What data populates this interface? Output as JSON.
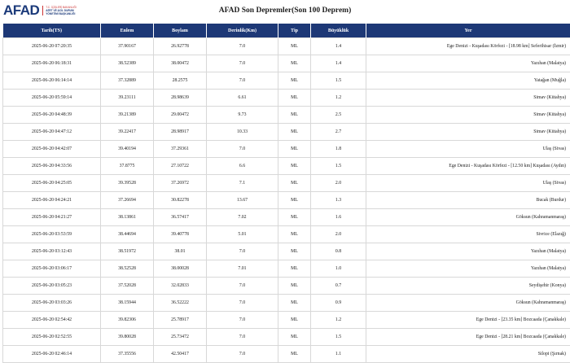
{
  "header": {
    "logo_text": "AFAD",
    "logo_sub": [
      "T.C. İÇİŞLERİ BAKANLIĞI",
      "AFET VE ACİL DURUM",
      "YÖNETİMİ BAŞKANLIĞI"
    ],
    "title": "AFAD Son Depremler(Son 100 Deprem)"
  },
  "columns": [
    "Tarih(TS)",
    "Enlem",
    "Boylam",
    "Derinlik(Km)",
    "Tip",
    "Büyüklük",
    "Yer"
  ],
  "rows": [
    [
      "2025-06-20 07:20:35",
      "37.90167",
      "26.92778",
      "7.0",
      "ML",
      "1.4",
      "Ege Denizi - Kuşadası Körfezi - [18.98 km] Seferihisar (İzmir)"
    ],
    [
      "2025-06-20 06:18:31",
      "38.52389",
      "38.00472",
      "7.0",
      "ML",
      "1.4",
      "Yazıhan (Malatya)"
    ],
    [
      "2025-06-20 06:14:14",
      "37.32889",
      "28.2575",
      "7.0",
      "ML",
      "1.5",
      "Yatağan (Muğla)"
    ],
    [
      "2025-06-20 05:59:14",
      "39.23111",
      "28.98639",
      "6.61",
      "ML",
      "1.2",
      "Simav (Kütahya)"
    ],
    [
      "2025-06-20 04:48:39",
      "39.21389",
      "29.00472",
      "9.73",
      "ML",
      "2.5",
      "Simav (Kütahya)"
    ],
    [
      "2025-06-20 04:47:12",
      "39.22417",
      "28.98917",
      "10.33",
      "ML",
      "2.7",
      "Simav (Kütahya)"
    ],
    [
      "2025-06-20 04:42:07",
      "39.40194",
      "37.29361",
      "7.0",
      "ML",
      "1.8",
      "Ulaş (Sivas)"
    ],
    [
      "2025-06-20 04:33:56",
      "37.8775",
      "27.10722",
      "6.6",
      "ML",
      "1.5",
      "Ege Denizi - Kuşadası Körfezi - [12.50 km] Kuşadası (Aydın)"
    ],
    [
      "2025-06-20 04:25:05",
      "39.39528",
      "37.26972",
      "7.1",
      "ML",
      "2.0",
      "Ulaş (Sivas)"
    ],
    [
      "2025-06-20 04:24:21",
      "37.26694",
      "30.82278",
      "13.67",
      "ML",
      "1.3",
      "Bucak (Burdur)"
    ],
    [
      "2025-06-20 04:21:27",
      "38.13861",
      "36.57417",
      "7.02",
      "ML",
      "1.6",
      "Göksun (Kahramanmaraş)"
    ],
    [
      "2025-06-20 03:53:59",
      "38.44694",
      "39.40778",
      "5.01",
      "ML",
      "2.0",
      "Sivrice (Elazığ)"
    ],
    [
      "2025-06-20 03:12:43",
      "38.51972",
      "38.01",
      "7.0",
      "ML",
      "0.8",
      "Yazıhan (Malatya)"
    ],
    [
      "2025-06-20 03:06:17",
      "38.52528",
      "38.00028",
      "7.01",
      "ML",
      "1.0",
      "Yazıhan (Malatya)"
    ],
    [
      "2025-06-20 03:05:23",
      "37.52028",
      "32.02833",
      "7.0",
      "ML",
      "0.7",
      "Seydişehir (Konya)"
    ],
    [
      "2025-06-20 03:03:26",
      "38.15944",
      "36.52222",
      "7.0",
      "ML",
      "0.9",
      "Göksun (Kahramanmaraş)"
    ],
    [
      "2025-06-20 02:54:42",
      "39.82306",
      "25.78917",
      "7.0",
      "ML",
      "1.2",
      "Ege Denizi - [23.35 km] Bozcaada (Çanakkale)"
    ],
    [
      "2025-06-20 02:52:55",
      "39.80028",
      "25.73472",
      "7.0",
      "ML",
      "1.5",
      "Ege Denizi - [28.21 km] Bozcaada (Çanakkale)"
    ],
    [
      "2025-06-20 02:46:14",
      "37.35556",
      "42.50417",
      "7.0",
      "ML",
      "1.1",
      "Silopi (Şırnak)"
    ]
  ]
}
